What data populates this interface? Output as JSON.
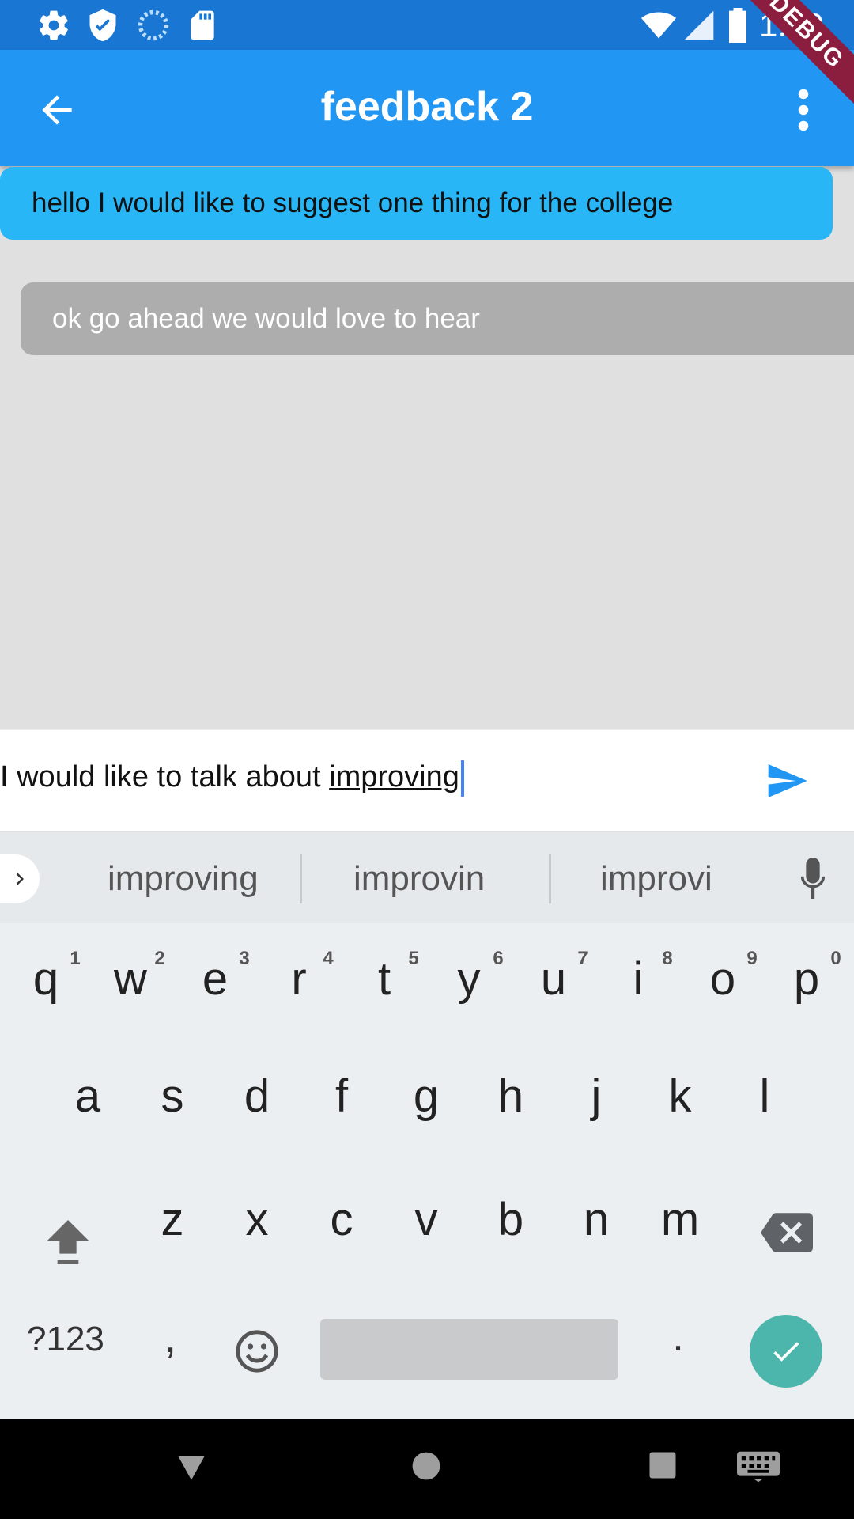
{
  "status_bar": {
    "clock": "1:10",
    "icons": [
      "settings-icon",
      "shield-icon",
      "sync-icon",
      "sd-card-icon",
      "wifi-icon",
      "signal-icon",
      "battery-icon"
    ]
  },
  "app_bar": {
    "title": "feedback 2",
    "debug_banner": "DEBUG"
  },
  "messages": [
    {
      "text": "hello I would like to suggest one thing for the college",
      "color": "#29b6f6"
    },
    {
      "text": "ok go ahead we would love to hear",
      "color": "#adadad"
    }
  ],
  "input": {
    "text_before": "I would like to talk about ",
    "composing": "improving"
  },
  "keyboard": {
    "suggestions": [
      "improving",
      "improvin",
      "improvi"
    ],
    "row1": [
      "q",
      "w",
      "e",
      "r",
      "t",
      "y",
      "u",
      "i",
      "o",
      "p"
    ],
    "row1_hints": [
      "1",
      "2",
      "3",
      "4",
      "5",
      "6",
      "7",
      "8",
      "9",
      "0"
    ],
    "row2": [
      "a",
      "s",
      "d",
      "f",
      "g",
      "h",
      "j",
      "k",
      "l"
    ],
    "row3": [
      "z",
      "x",
      "c",
      "v",
      "b",
      "n",
      "m"
    ],
    "symbols_label": "?123",
    "comma": ",",
    "period": "."
  },
  "colors": {
    "status_bar": "#1976d2",
    "app_bar": "#2196f3",
    "accent": "#2196f3",
    "enter_key": "#4db6ac"
  }
}
